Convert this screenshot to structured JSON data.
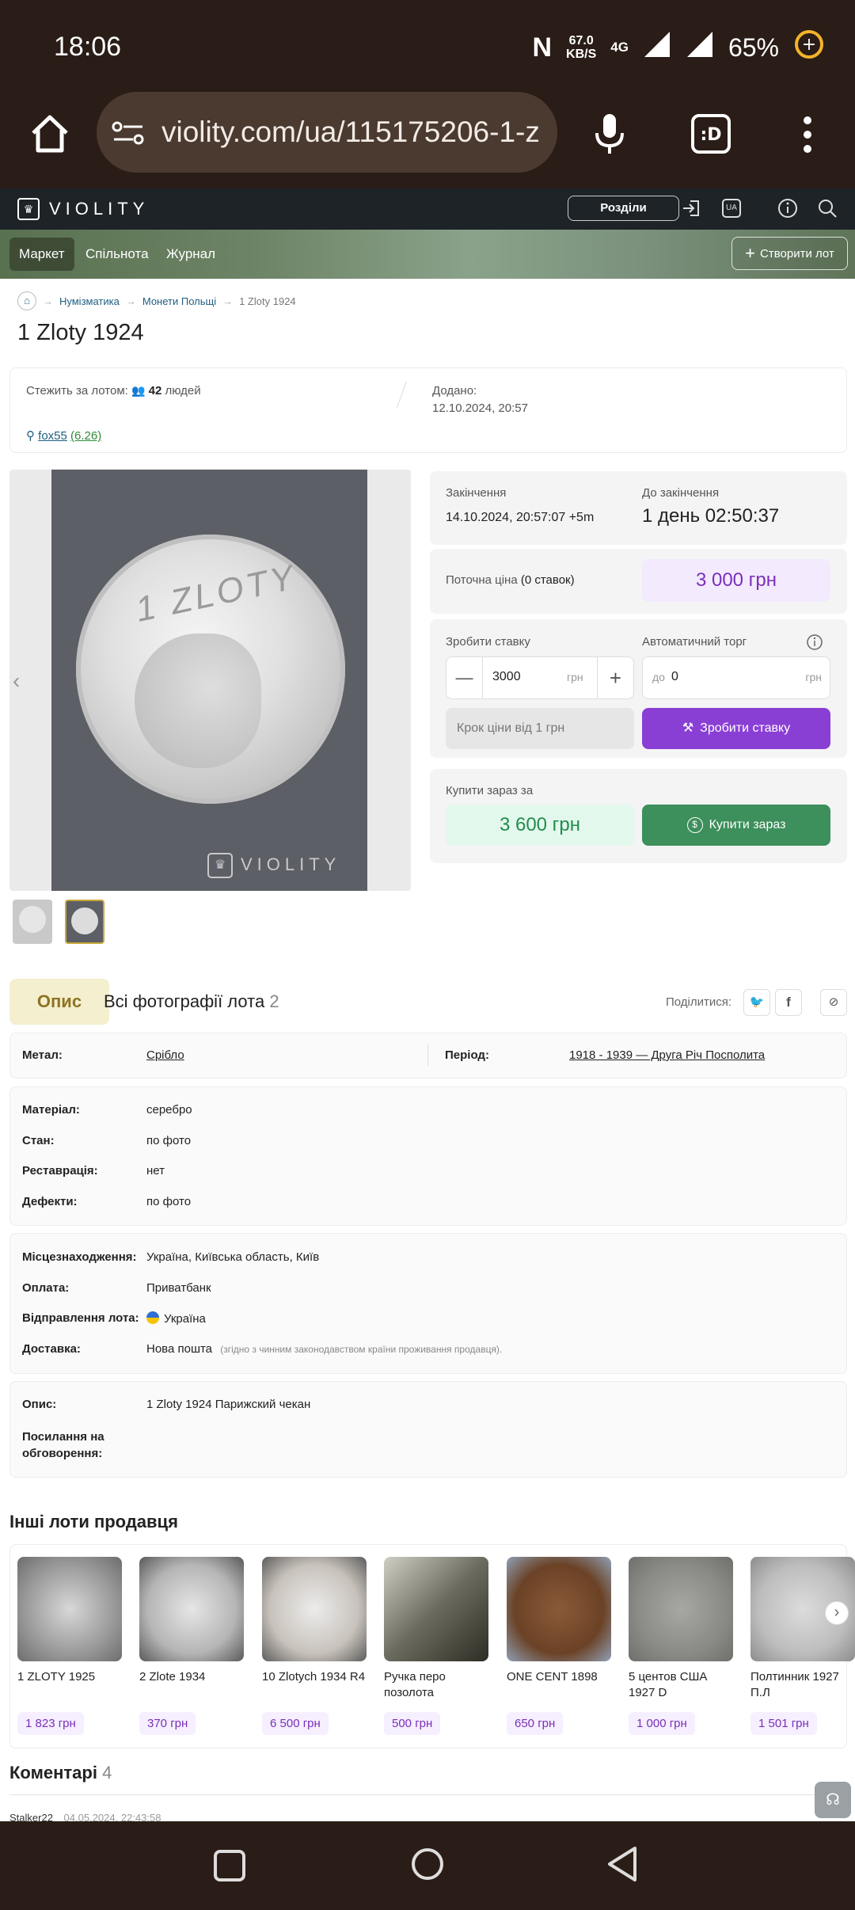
{
  "status_bar": {
    "time": "18:06",
    "speed_value": "67.0",
    "speed_unit": "KB/S",
    "network": "4G",
    "battery": "65%"
  },
  "browser": {
    "url": "violity.com/ua/115175206-1-z"
  },
  "site": {
    "brand": "VIOLITY",
    "sections_button": "Розділи",
    "lang": "UA",
    "tabs": [
      "Маркет",
      "Спільнота",
      "Журнал"
    ],
    "create_lot": "Створити лот"
  },
  "breadcrumb": [
    "Нумізматика",
    "Монети Польщі",
    "1 Zloty 1924"
  ],
  "title": "1 Zloty 1924",
  "watch": {
    "label": "Стежить за лотом:",
    "count": "42",
    "suffix": "людей",
    "added_label": "Додано:",
    "added_value": "12.10.2024, 20:57",
    "seller": "fox55",
    "rating": "(6.26)"
  },
  "gallery": {
    "watermark": "VIOLITY",
    "coin_text": "1 ZLOTY"
  },
  "auction": {
    "end_label": "Закінчення",
    "end_value": "14.10.2024, 20:57:07 +5m",
    "remaining_label": "До закінчення",
    "remaining_value": "1 день 02:50:37",
    "current_price_label": "Поточна ціна",
    "bids_note": "(0 ставок)",
    "current_price": "3 000 грн",
    "bid_label": "Зробити ставку",
    "auto_label": "Автоматичний торг",
    "bid_value": "3000",
    "currency": "грн",
    "auto_prefix": "до",
    "auto_value": "0",
    "step_text": "Крок ціни від 1 грн",
    "bid_button": "Зробити ставку",
    "buy_now_label": "Купити зараз за",
    "buy_now_price": "3 600 грн",
    "buy_now_button": "Купити зараз"
  },
  "description_tabs": {
    "active": "Опис",
    "photos": "Всі фотографії лота",
    "photos_count": "2",
    "share": "Поділитися:"
  },
  "attributes": {
    "metal_k": "Метал:",
    "metal_v": "Срібло",
    "period_k": "Період:",
    "period_v": "1918 - 1939 — Друга Річ Посполита",
    "material_k": "Матеріал:",
    "material_v": "серебро",
    "state_k": "Стан:",
    "state_v": "по фото",
    "restoration_k": "Реставрація:",
    "restoration_v": "нет",
    "defects_k": "Дефекти:",
    "defects_v": "по фото",
    "location_k": "Місцезнаходження:",
    "location_v": "Україна, Київська область, Київ",
    "payment_k": "Оплата:",
    "payment_v": "Приватбанк",
    "shipping_k": "Відправлення лота:",
    "shipping_v": "Україна",
    "delivery_k": "Доставка:",
    "delivery_v": "Нова пошта",
    "delivery_note": "(згідно з чинним законодавством країни проживання продавця).",
    "desc_k": "Опис:",
    "desc_v": "1 Zloty 1924 Парижский чекан",
    "links_k1": "Посилання на",
    "links_k2": "обговорення:"
  },
  "other_lots": {
    "title": "Інші лоти продавця",
    "items": [
      {
        "name": "1 ZLOTY 1925",
        "price": "1 823 грн"
      },
      {
        "name": "2 Zlote 1934",
        "price": "370 грн"
      },
      {
        "name": "10 Zlotych 1934 R4",
        "price": "6 500 грн"
      },
      {
        "name": "Ручка перо позолота",
        "price": "500 грн"
      },
      {
        "name": "ONE CENT 1898",
        "price": "650 грн"
      },
      {
        "name": "5 центов США 1927 D",
        "price": "1 000 грн"
      },
      {
        "name": "Полтинник 1927 П.Л",
        "price": "1 501 грн"
      }
    ]
  },
  "comments": {
    "title": "Коментарі",
    "count": "4",
    "first_user": "Stalker22",
    "first_time": "04.05.2024, 22:43:58"
  }
}
